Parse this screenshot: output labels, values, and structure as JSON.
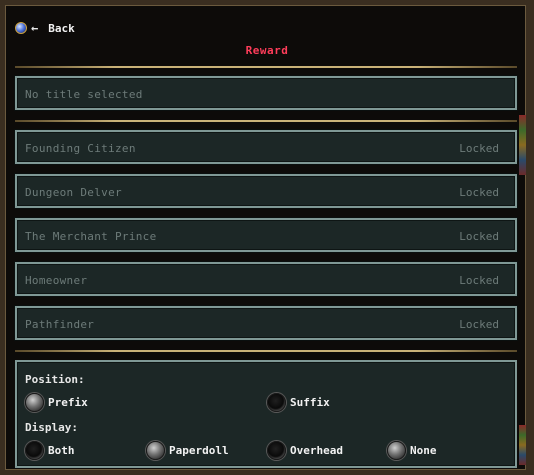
{
  "nav": {
    "back_label": "Back",
    "back_arrow": "←"
  },
  "header": {
    "title": "Reward"
  },
  "current": {
    "text": "No title selected"
  },
  "titles": [
    {
      "name": "Founding Citizen",
      "status": "Locked"
    },
    {
      "name": "Dungeon Delver",
      "status": "Locked"
    },
    {
      "name": "The Merchant Prince",
      "status": "Locked"
    },
    {
      "name": "Homeowner",
      "status": "Locked"
    },
    {
      "name": "Pathfinder",
      "status": "Locked"
    }
  ],
  "position": {
    "label": "Position:",
    "options": [
      {
        "label": "Prefix",
        "selected": false
      },
      {
        "label": "Suffix",
        "selected": true
      }
    ]
  },
  "display": {
    "label": "Display:",
    "options": [
      {
        "label": "Both",
        "selected": true
      },
      {
        "label": "Paperdoll",
        "selected": false
      },
      {
        "label": "Overhead",
        "selected": true
      },
      {
        "label": "None",
        "selected": false
      }
    ]
  },
  "colors": {
    "reward_title": "#ff3d5a",
    "row_text": "#6d7b79",
    "row_border": "#7f9895",
    "row_bg": "#1c2726"
  }
}
